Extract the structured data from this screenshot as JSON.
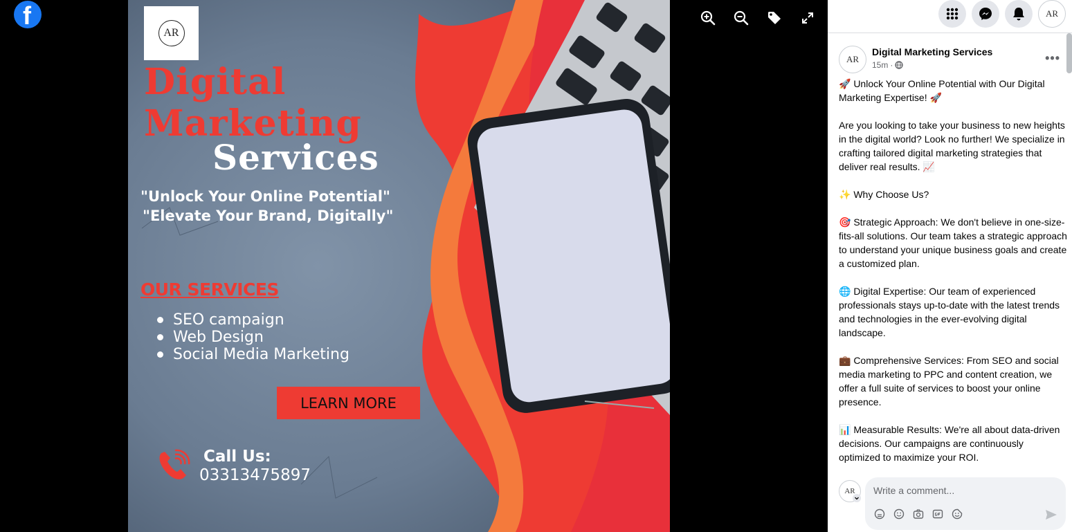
{
  "app": {
    "logo_glyph": "f",
    "logo_color": "#1877f2"
  },
  "viewer": {
    "tools": [
      "zoom-in-icon",
      "zoom-out-icon",
      "tag-icon",
      "fullscreen-icon"
    ]
  },
  "poster": {
    "logo_text": "AR",
    "title_line1": "Digital",
    "title_line2": "Marketing",
    "title_line3": "Services",
    "tagline1": "\"Unlock Your Online Potential\"",
    "tagline2": "\"Elevate Your Brand, Digitally\"",
    "services_heading": "OUR SERVICES",
    "services": [
      "SEO campaign",
      "Web Design",
      "Social Media Marketing"
    ],
    "cta": "LEARN MORE",
    "call_label": "Call Us:",
    "phone": "03313475897",
    "accent_color": "#ee3b33"
  },
  "topbar": {
    "icons": [
      "menu-grid-icon",
      "messenger-icon",
      "notifications-icon",
      "profile-avatar"
    ],
    "avatar_text": "AR"
  },
  "post": {
    "avatar_text": "AR",
    "page_name": "Digital Marketing Services",
    "time": "15m",
    "audience_icon": "globe-icon",
    "paragraphs": [
      "🚀 Unlock Your Online Potential with Our Digital Marketing Expertise! 🚀",
      "Are you looking to take your business to new heights in the digital world? Look no further! We specialize in crafting tailored digital marketing strategies that deliver real results. 📈",
      "✨ Why Choose Us?",
      "🎯 Strategic Approach: We don't believe in one-size-fits-all solutions. Our team takes a strategic approach to understand your unique business goals and create a customized plan.",
      "🌐 Digital Expertise: Our team of experienced professionals stays up-to-date with the latest trends and technologies in the ever-evolving digital landscape.",
      "💼 Comprehensive Services: From SEO and social media marketing to PPC and content creation, we offer a full suite of services to boost your online presence.",
      "📊 Measurable Results: We're all about data-driven decisions. Our campaigns are continuously optimized to maximize your ROI."
    ]
  },
  "comment": {
    "avatar_text": "AR",
    "placeholder": "Write a comment..."
  }
}
